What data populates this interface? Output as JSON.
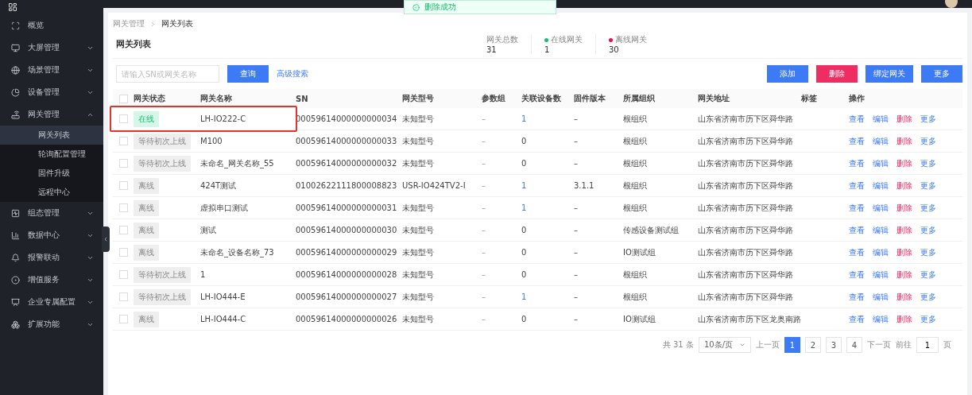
{
  "toast": {
    "text": "删除成功"
  },
  "sidebar": {
    "items": [
      {
        "label": "概览"
      },
      {
        "label": "大屏管理",
        "expanded": false
      },
      {
        "label": "场景管理",
        "expanded": false
      },
      {
        "label": "设备管理",
        "expanded": false
      },
      {
        "label": "网关管理",
        "expanded": true,
        "children": [
          {
            "label": "网关列表",
            "selected": true
          },
          {
            "label": "轮询配置管理",
            "selected": false
          },
          {
            "label": "固件升级",
            "selected": false
          },
          {
            "label": "远程中心",
            "selected": false
          }
        ]
      },
      {
        "label": "组态管理",
        "expanded": false
      },
      {
        "label": "数据中心",
        "expanded": false
      },
      {
        "label": "报警联动",
        "expanded": false
      },
      {
        "label": "增值服务",
        "expanded": false
      },
      {
        "label": "企业专属配置",
        "expanded": false
      },
      {
        "label": "扩展功能",
        "expanded": false
      }
    ]
  },
  "breadcrumb": [
    "网关管理",
    "网关列表"
  ],
  "page_title": "网关列表",
  "stats": [
    {
      "label": "网关总数",
      "value": "31"
    },
    {
      "label": "在线网关",
      "value": "1",
      "color": "#19be6b"
    },
    {
      "label": "离线网关",
      "value": "30",
      "color": "#e8104a"
    }
  ],
  "search": {
    "placeholder": "请输入SN或网关名称",
    "button": "查询",
    "advanced": "高级搜索"
  },
  "actions": [
    {
      "label": "添加",
      "kind": "primary"
    },
    {
      "label": "删除",
      "kind": "danger"
    },
    {
      "label": "绑定网关",
      "kind": "primary"
    },
    {
      "label": "更多",
      "kind": "primary"
    }
  ],
  "table": {
    "all_checked": false,
    "columns": [
      "网关状态",
      "网关名称",
      "SN",
      "网关型号",
      "参数组",
      "关联设备数",
      "固件版本",
      "所属组织",
      "网关地址",
      "标签",
      "操作"
    ],
    "rows": [
      {
        "checked": false,
        "highlighted": true,
        "status": "在线",
        "kind": "online",
        "name": "LH-IO222-C",
        "sn": "00059614000000000034",
        "model": "未知型号",
        "params": "–",
        "devices": "1",
        "firmware": "–",
        "org": "根组织",
        "address": "山东省济南市历下区舜华路",
        "ops": [
          "查看",
          "编辑",
          "删除",
          "更多"
        ]
      },
      {
        "checked": false,
        "highlighted": false,
        "status": "等待初次上线",
        "kind": "waiting",
        "name": "M100",
        "sn": "00059614000000000033",
        "model": "未知型号",
        "params": "–",
        "devices": "0",
        "firmware": "–",
        "org": "根组织",
        "address": "山东省济南市历下区舜华路",
        "ops": [
          "查看",
          "编辑",
          "删除",
          "更多"
        ]
      },
      {
        "checked": false,
        "highlighted": false,
        "status": "等待初次上线",
        "kind": "waiting",
        "name": "未命名_网关名称_55",
        "sn": "00059614000000000032",
        "model": "未知型号",
        "params": "–",
        "devices": "0",
        "firmware": "–",
        "org": "根组织",
        "address": "山东省济南市历下区舜华路",
        "ops": [
          "查看",
          "编辑",
          "删除",
          "更多"
        ]
      },
      {
        "checked": false,
        "highlighted": false,
        "status": "离线",
        "kind": "offline",
        "name": "424T测试",
        "sn": "01002622111800008823",
        "model": "USR-IO424TV2-I",
        "params": "–",
        "devices": "1",
        "firmware": "3.1.1",
        "org": "根组织",
        "address": "山东省济南市历下区舜华路",
        "ops": [
          "查看",
          "编辑",
          "删除",
          "更多"
        ]
      },
      {
        "checked": false,
        "highlighted": false,
        "status": "离线",
        "kind": "offline",
        "name": "虚拟串口测试",
        "sn": "00059614000000000031",
        "model": "未知型号",
        "params": "–",
        "devices": "1",
        "firmware": "–",
        "org": "根组织",
        "address": "山东省济南市历下区舜华路",
        "ops": [
          "查看",
          "编辑",
          "删除",
          "更多"
        ]
      },
      {
        "checked": false,
        "highlighted": false,
        "status": "离线",
        "kind": "offline",
        "name": "测试",
        "sn": "00059614000000000030",
        "model": "未知型号",
        "params": "–",
        "devices": "0",
        "firmware": "–",
        "org": "传感设备测试组",
        "address": "山东省济南市历下区舜华路",
        "ops": [
          "查看",
          "编辑",
          "删除",
          "更多"
        ]
      },
      {
        "checked": false,
        "highlighted": false,
        "status": "离线",
        "kind": "offline",
        "name": "未命名_设备名称_73",
        "sn": "00059614000000000029",
        "model": "未知型号",
        "params": "–",
        "devices": "0",
        "firmware": "–",
        "org": "IO测试组",
        "address": "山东省济南市历下区舜华路",
        "ops": [
          "查看",
          "编辑",
          "删除",
          "更多"
        ]
      },
      {
        "checked": false,
        "highlighted": false,
        "status": "等待初次上线",
        "kind": "waiting",
        "name": "1",
        "sn": "00059614000000000028",
        "model": "未知型号",
        "params": "–",
        "devices": "0",
        "firmware": "–",
        "org": "根组织",
        "address": "山东省济南市历下区舜华路",
        "ops": [
          "查看",
          "编辑",
          "删除",
          "更多"
        ]
      },
      {
        "checked": false,
        "highlighted": false,
        "status": "等待初次上线",
        "kind": "waiting",
        "name": "LH-IO444-E",
        "sn": "00059614000000000027",
        "model": "未知型号",
        "params": "–",
        "devices": "1",
        "firmware": "–",
        "org": "根组织",
        "address": "山东省济南市历下区舜华路",
        "ops": [
          "查看",
          "编辑",
          "删除",
          "更多"
        ]
      },
      {
        "checked": false,
        "highlighted": false,
        "status": "离线",
        "kind": "offline",
        "name": "LH-IO444-C",
        "sn": "00059614000000000026",
        "model": "未知型号",
        "params": "–",
        "devices": "0",
        "firmware": "–",
        "org": "IO测试组",
        "address": "山东省济南市历下区龙奥南路",
        "ops": [
          "查看",
          "编辑",
          "删除",
          "更多"
        ]
      }
    ]
  },
  "pagination": {
    "total": "共 31 条",
    "page_size": "10条/页",
    "prev": "上一页",
    "pages": [
      {
        "label": "1",
        "selected": true
      },
      {
        "label": "2",
        "selected": false
      },
      {
        "label": "3",
        "selected": false
      },
      {
        "label": "4",
        "selected": false
      }
    ],
    "next": "下一页",
    "goto": "前往",
    "goto_value": "1",
    "page_unit": "页"
  }
}
